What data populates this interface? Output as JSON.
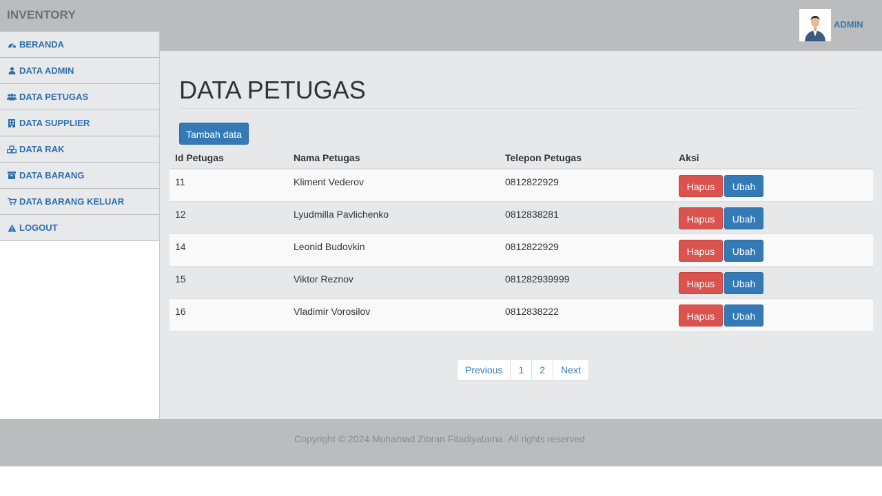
{
  "app": {
    "brand": "INVENTORY",
    "user_label": "ADMIN"
  },
  "sidebar": {
    "items": [
      {
        "label": "BERANDA",
        "icon": "dashboard-icon"
      },
      {
        "label": "DATA ADMIN",
        "icon": "user-icon"
      },
      {
        "label": "DATA PETUGAS",
        "icon": "users-icon"
      },
      {
        "label": "DATA SUPPLIER",
        "icon": "building-icon"
      },
      {
        "label": "DATA RAK",
        "icon": "cubes-icon"
      },
      {
        "label": "DATA BARANG",
        "icon": "archive-icon"
      },
      {
        "label": "DATA BARANG KELUAR",
        "icon": "cart-icon"
      },
      {
        "label": "LOGOUT",
        "icon": "warning-icon"
      }
    ]
  },
  "main": {
    "title": "DATA PETUGAS",
    "add_button": "Tambah data",
    "table": {
      "headers": [
        "Id Petugas",
        "Nama Petugas",
        "Telepon Petugas",
        "Aksi"
      ],
      "rows": [
        {
          "id": "11",
          "name": "Kliment Vederov",
          "phone": "0812822929"
        },
        {
          "id": "12",
          "name": "Lyudmilla Pavlichenko",
          "phone": "0812838281"
        },
        {
          "id": "14",
          "name": "Leonid Budovkin",
          "phone": "0812822929"
        },
        {
          "id": "15",
          "name": "Viktor Reznov",
          "phone": "081282939999"
        },
        {
          "id": "16",
          "name": "Vladimir Vorosilov",
          "phone": "0812838222"
        }
      ],
      "delete_label": "Hapus",
      "edit_label": "Ubah"
    },
    "pagination": {
      "previous": "Previous",
      "pages": [
        "1",
        "2"
      ],
      "next": "Next"
    }
  },
  "footer": {
    "text": "Copyright © 2024 Muhamad Zibran Fitadiyatama. All rights reserved"
  },
  "colors": {
    "primary": "#337ab7",
    "danger": "#d9534f",
    "header_bg": "#bbbcbe",
    "content_bg": "#e7e8ea"
  }
}
